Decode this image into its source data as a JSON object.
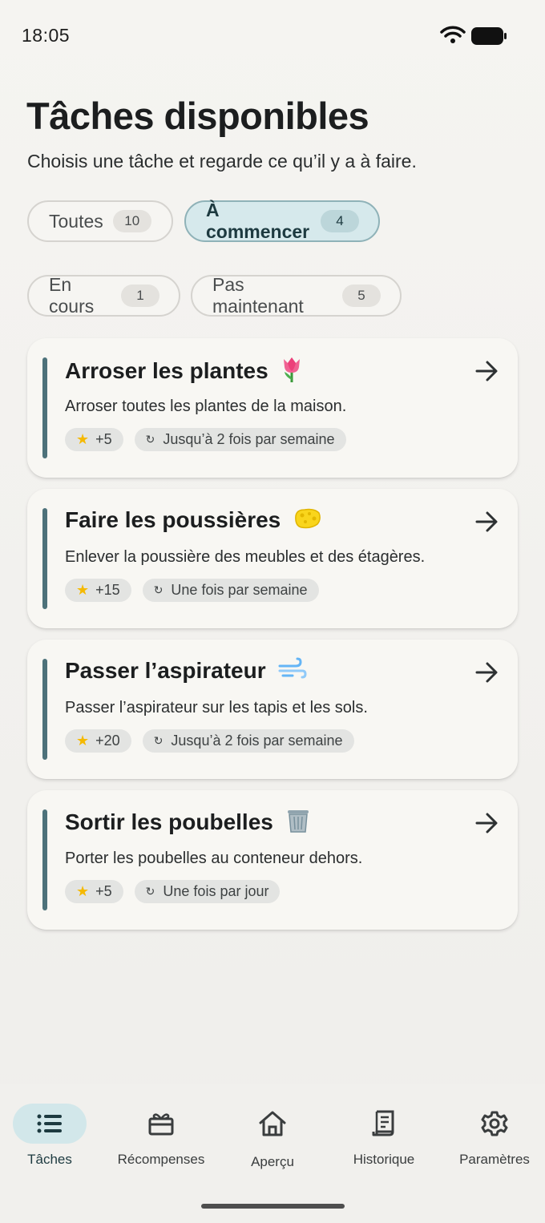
{
  "status": {
    "time": "18:05"
  },
  "header": {
    "title": "Tâches disponibles",
    "subtitle": "Choisis une tâche et regarde ce qu’il y a à faire."
  },
  "filters": [
    {
      "label": "Toutes",
      "count": "10",
      "active": false
    },
    {
      "label": "À commencer",
      "count": "4",
      "active": true
    },
    {
      "label": "En cours",
      "count": "1",
      "active": false
    },
    {
      "label": "Pas maintenant",
      "count": "5",
      "active": false
    }
  ],
  "tasks": [
    {
      "title": "Arroser les plantes",
      "emoji": "🌷",
      "description": "Arroser toutes les plantes de la maison.",
      "points": "+5",
      "frequency": "Jusqu’à 2 fois par semaine"
    },
    {
      "title": "Faire les poussières",
      "emoji": "🧽",
      "description": "Enlever la poussière des meubles et des étagères.",
      "points": "+15",
      "frequency": "Une fois par semaine"
    },
    {
      "title": "Passer l’aspirateur",
      "emoji": "💨",
      "description": "Passer l’aspirateur sur les tapis et les sols.",
      "points": "+20",
      "frequency": "Jusqu’à 2 fois par semaine"
    },
    {
      "title": "Sortir les poubelles",
      "emoji": "🗑️",
      "description": "Porter les poubelles au conteneur dehors.",
      "points": "+5",
      "frequency": "Une fois par jour"
    }
  ],
  "nav": [
    {
      "label": "Tâches",
      "icon": "list-icon",
      "active": true
    },
    {
      "label": "Récompenses",
      "icon": "gift-icon",
      "active": false
    },
    {
      "label": "Aperçu",
      "icon": "home-icon",
      "active": false
    },
    {
      "label": "Historique",
      "icon": "receipt-icon",
      "active": false
    },
    {
      "label": "Paramètres",
      "icon": "gear-icon",
      "active": false
    }
  ],
  "colors": {
    "accent": "#4d727a",
    "active_chip_bg": "#d6e9ec",
    "star": "#f5b900"
  }
}
